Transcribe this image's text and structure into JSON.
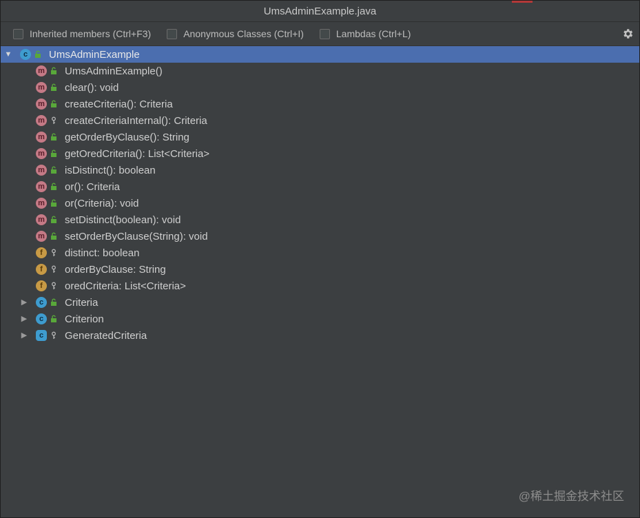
{
  "window": {
    "title": "UmsAdminExample.java"
  },
  "toolbar": {
    "options": [
      {
        "label": "Inherited members (Ctrl+F3)",
        "checked": false
      },
      {
        "label": "Anonymous Classes (Ctrl+I)",
        "checked": false
      },
      {
        "label": "Lambdas (Ctrl+L)",
        "checked": false
      }
    ],
    "settings_icon": "gear-icon"
  },
  "tree": {
    "root": {
      "label": "UmsAdminExample",
      "kind": "class",
      "expanded": true,
      "selected": true
    },
    "members": [
      {
        "label": "UmsAdminExample()",
        "kind": "method",
        "visibility": "public"
      },
      {
        "label": "clear(): void",
        "kind": "method",
        "visibility": "public"
      },
      {
        "label": "createCriteria(): Criteria",
        "kind": "method",
        "visibility": "public"
      },
      {
        "label": "createCriteriaInternal(): Criteria",
        "kind": "method",
        "visibility": "protected"
      },
      {
        "label": "getOrderByClause(): String",
        "kind": "method",
        "visibility": "public"
      },
      {
        "label": "getOredCriteria(): List<Criteria>",
        "kind": "method",
        "visibility": "public"
      },
      {
        "label": "isDistinct(): boolean",
        "kind": "method",
        "visibility": "public"
      },
      {
        "label": "or(): Criteria",
        "kind": "method",
        "visibility": "public"
      },
      {
        "label": "or(Criteria): void",
        "kind": "method",
        "visibility": "public"
      },
      {
        "label": "setDistinct(boolean): void",
        "kind": "method",
        "visibility": "public"
      },
      {
        "label": "setOrderByClause(String): void",
        "kind": "method",
        "visibility": "public"
      },
      {
        "label": "distinct: boolean",
        "kind": "field",
        "visibility": "protected"
      },
      {
        "label": "orderByClause: String",
        "kind": "field",
        "visibility": "protected"
      },
      {
        "label": "oredCriteria: List<Criteria>",
        "kind": "field",
        "visibility": "protected"
      },
      {
        "label": "Criteria",
        "kind": "inner-class",
        "visibility": "public",
        "expandable": true
      },
      {
        "label": "Criterion",
        "kind": "inner-class",
        "visibility": "public",
        "expandable": true
      },
      {
        "label": "GeneratedCriteria",
        "kind": "abstract-class",
        "visibility": "protected",
        "expandable": true
      }
    ]
  },
  "kind_letters": {
    "method": "m",
    "field": "f",
    "class": "c",
    "inner-class": "c",
    "abstract-class": "c"
  },
  "colors": {
    "selection": "#4b6eaf",
    "method_icon": "#c57a86",
    "field_icon": "#c89a45",
    "class_icon": "#3e9ccf",
    "public_lock": "#59a83a"
  },
  "watermark": "@稀土掘金技术社区"
}
